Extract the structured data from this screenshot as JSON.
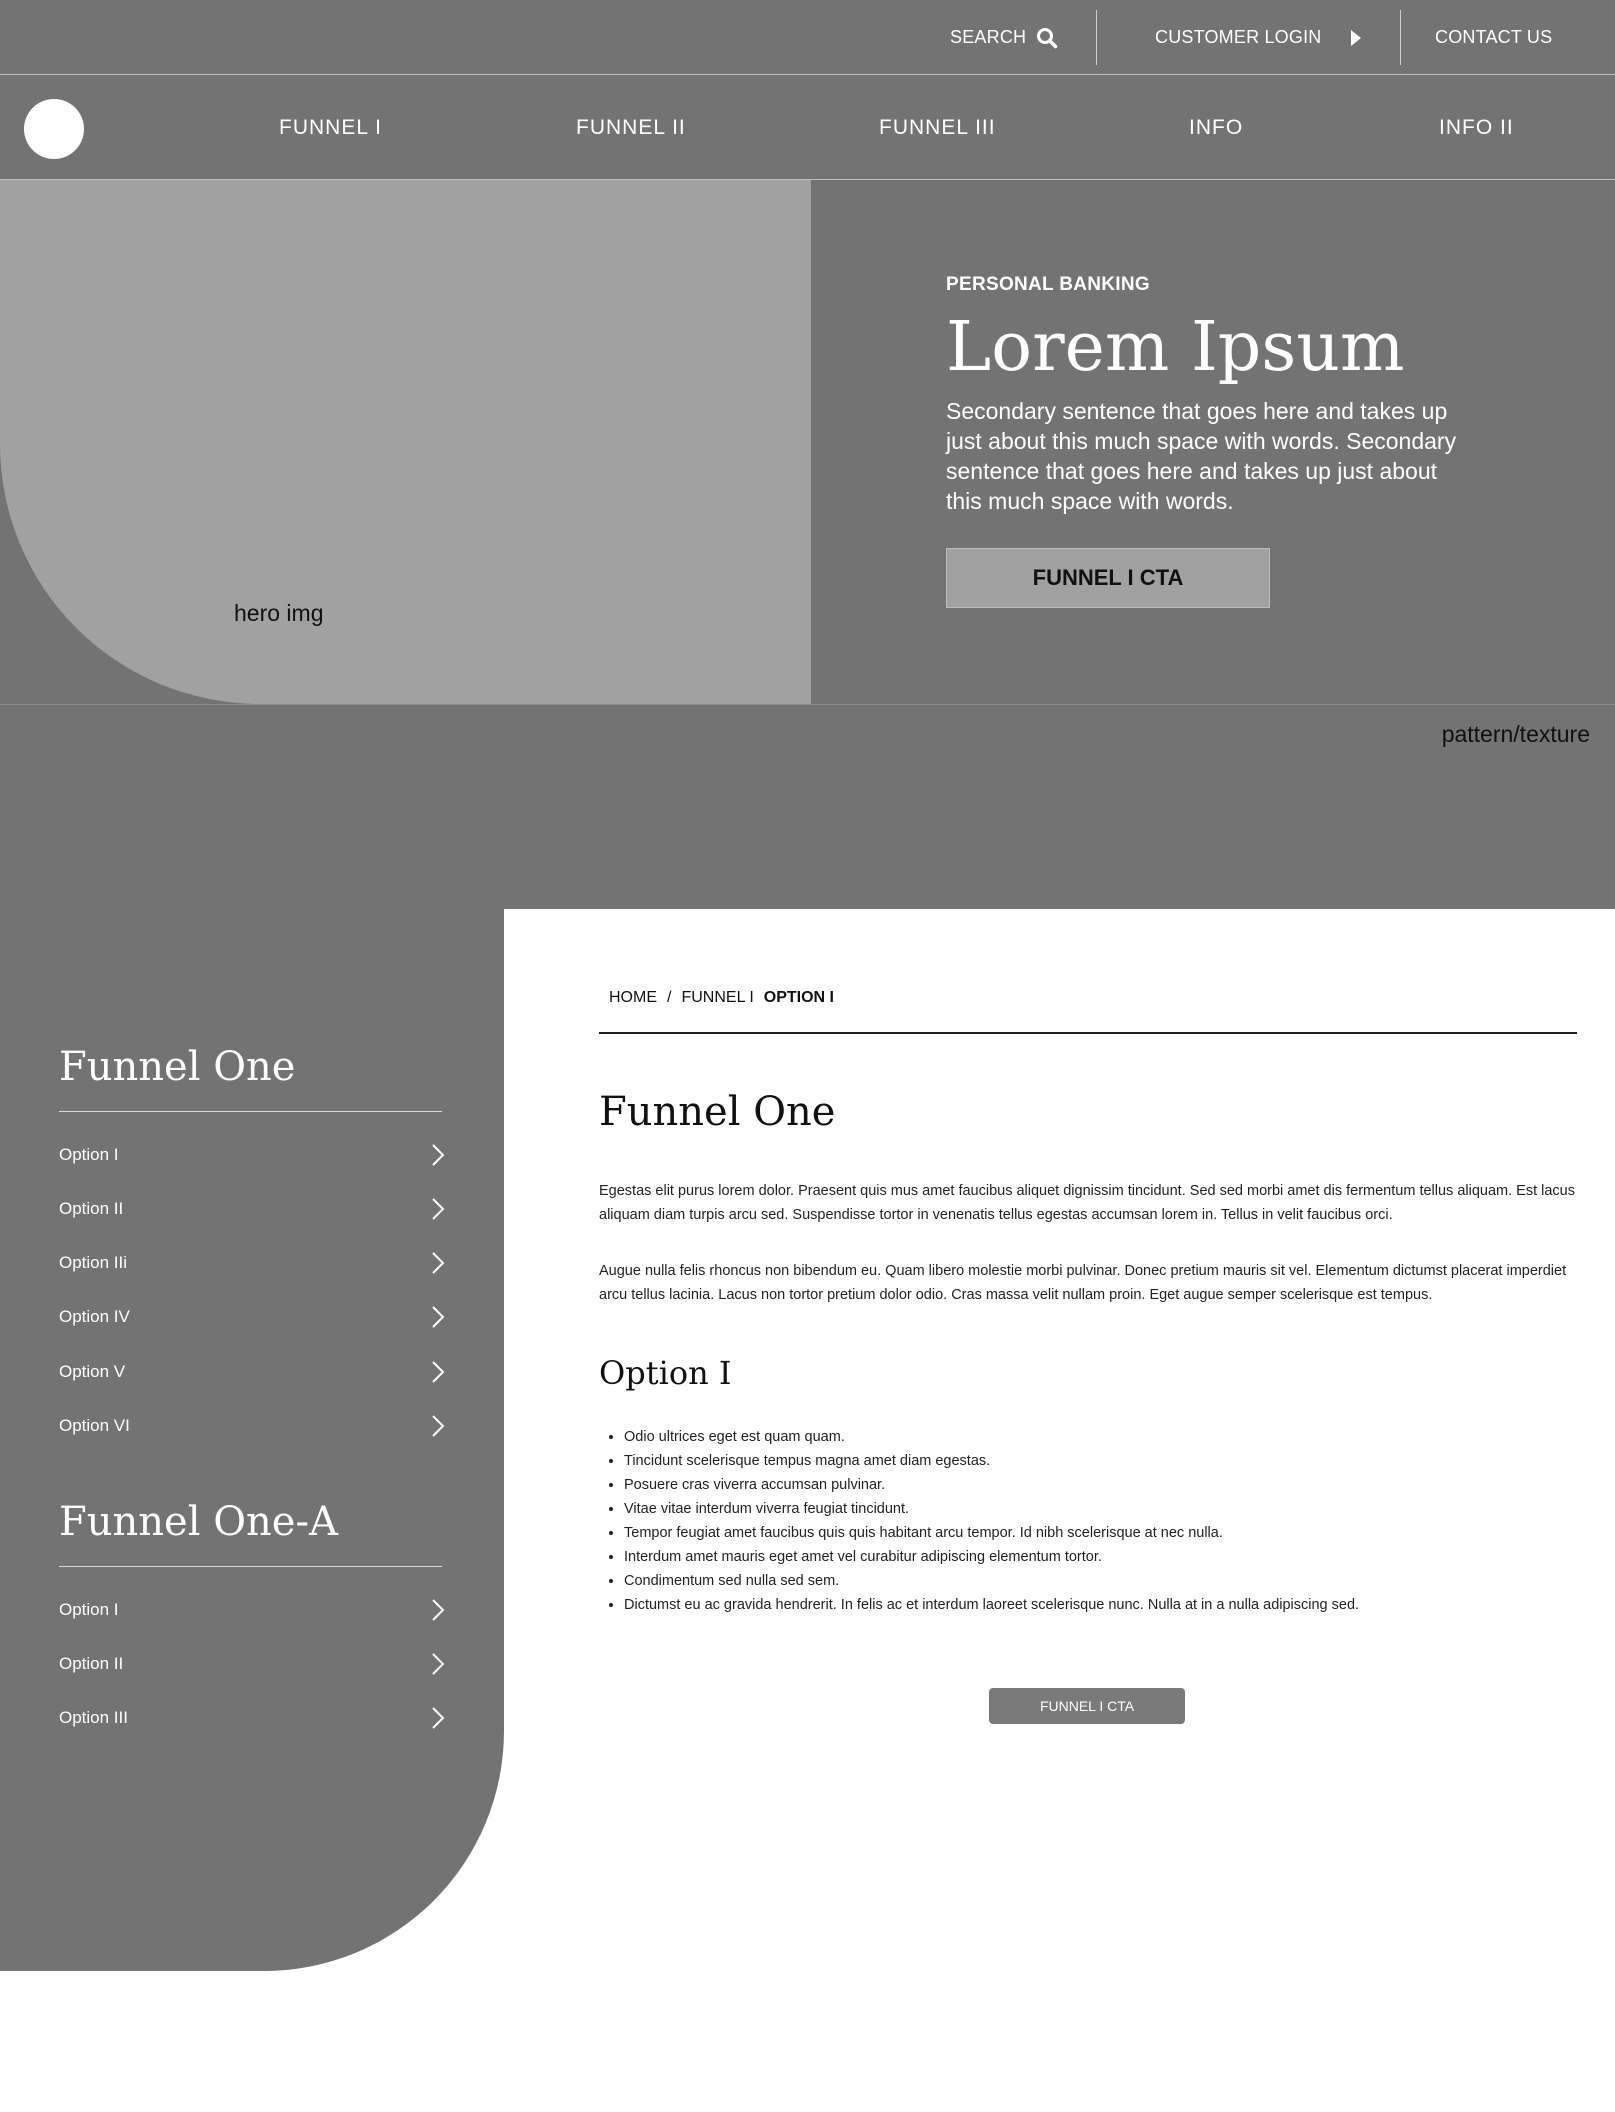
{
  "utility": {
    "search_label": "SEARCH",
    "login_label": "CUSTOMER LOGIN",
    "contact_label": "CONTACT US"
  },
  "nav": {
    "items": [
      "FUNNEL I",
      "FUNNEL II",
      "FUNNEL III",
      "INFO",
      "INFO II"
    ]
  },
  "hero": {
    "image_label": "hero img",
    "kicker": "PERSONAL BANKING",
    "title": "Lorem Ipsum",
    "subtitle": "Secondary sentence that goes here and takes up just about this much space with words. Secondary sentence that goes here and takes up just about this much space with words.",
    "cta_label": "FUNNEL I CTA",
    "pattern_label": "pattern/texture"
  },
  "sidebar": {
    "groups": [
      {
        "heading": "Funnel One",
        "items": [
          "Option I",
          "Option II",
          "Option IIi",
          "Option IV",
          "Option V",
          "Option VI"
        ]
      },
      {
        "heading": "Funnel One-A",
        "items": [
          "Option I",
          "Option II",
          "Option III"
        ]
      }
    ]
  },
  "main": {
    "breadcrumb": {
      "home": "HOME",
      "sep": "/",
      "parent": "FUNNEL I",
      "current": "OPTION I"
    },
    "title": "Funnel One",
    "paragraphs": [
      "Egestas elit purus lorem dolor. Praesent quis mus amet faucibus aliquet dignissim tincidunt. Sed sed morbi amet dis fermentum tellus aliquam. Est lacus aliquam diam turpis arcu sed. Suspendisse tortor in venenatis tellus egestas accumsan lorem in. Tellus in velit faucibus orci.",
      "Augue nulla felis rhoncus non bibendum eu. Quam libero molestie morbi pulvinar. Donec pretium mauris sit vel. Elementum dictumst placerat imperdiet arcu tellus lacinia. Lacus non tortor pretium dolor odio. Cras massa velit nullam proin. Eget augue semper scelerisque est tempus."
    ],
    "option_title": "Option I",
    "bullets": [
      "Odio ultrices eget est quam quam.",
      "Tincidunt scelerisque tempus magna amet diam egestas.",
      "Posuere cras viverra accumsan pulvinar.",
      "Vitae vitae interdum viverra feugiat tincidunt.",
      "Tempor feugiat amet faucibus quis quis habitant arcu tempor. Id nibh scelerisque at nec nulla.",
      "Interdum amet mauris eget amet vel curabitur adipiscing elementum tortor.",
      "Condimentum sed nulla sed sem.",
      "Dictumst eu ac gravida hendrerit. In felis ac et interdum laoreet scelerisque nunc. Nulla at in a nulla adipiscing sed."
    ],
    "cta_label": "FUNNEL I CTA"
  },
  "icons": {
    "search": "search-icon",
    "login_arrow": "caret-right-icon",
    "chevron": "chevron-right-icon",
    "logo": "logo-circle"
  },
  "colors": {
    "header_gray": "#737373",
    "hero_image_gray": "#a1a1a1",
    "white": "#ffffff",
    "cta_gray": "#7a7a7a"
  }
}
